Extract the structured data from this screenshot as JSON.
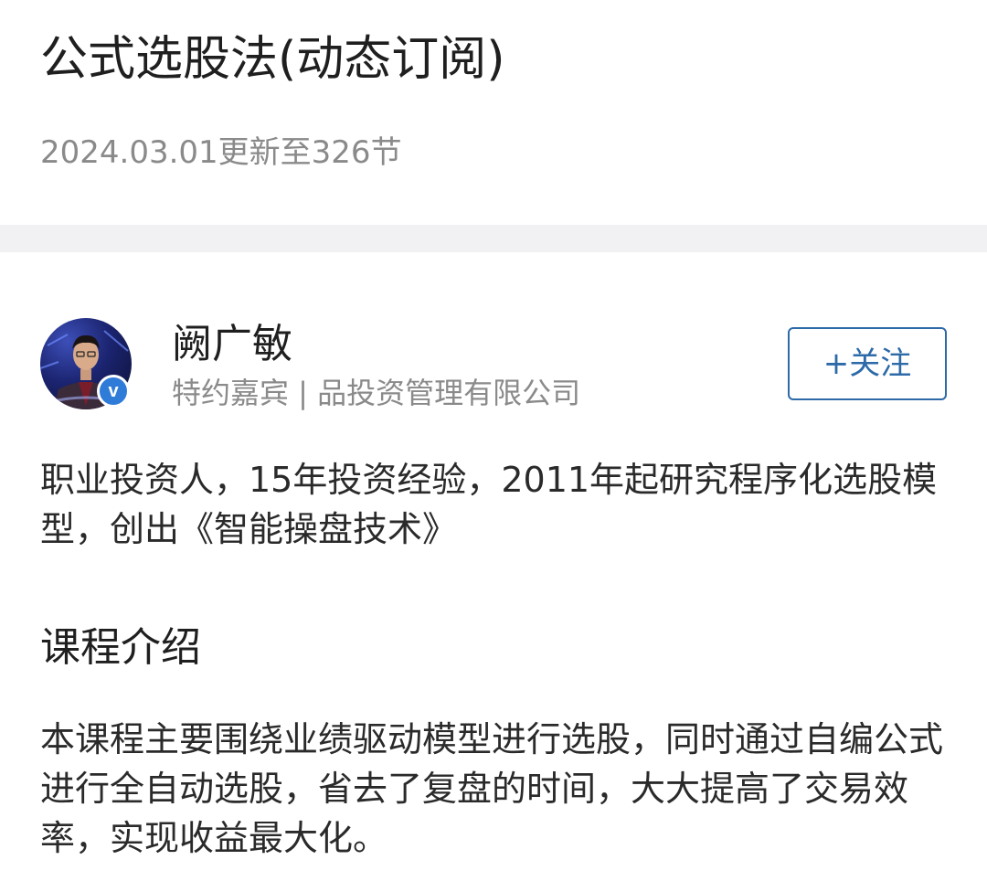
{
  "course": {
    "title": "公式选股法(动态订阅)",
    "update_info": "2024.03.01更新至326节"
  },
  "author": {
    "name": "阙广敏",
    "title": "特约嘉宾 | 品投资管理有限公司",
    "verified_mark": "v",
    "follow_label": "+关注",
    "bio": "职业投资人，15年投资经验，2011年起研究程序化选股模型，创出《智能操盘技术》"
  },
  "intro": {
    "heading": "课程介绍",
    "text": " 本课程主要围绕业绩驱动模型进行选股，同时通过自编公式进行全自动选股，省去了复盘的时间，大大提高了交易效率，实现收益最大化。"
  },
  "colors": {
    "accent": "#2d6aa8",
    "verified_badge": "#2f7bd8",
    "secondary_text": "#8a8a8a",
    "divider": "#f1f1f3"
  }
}
